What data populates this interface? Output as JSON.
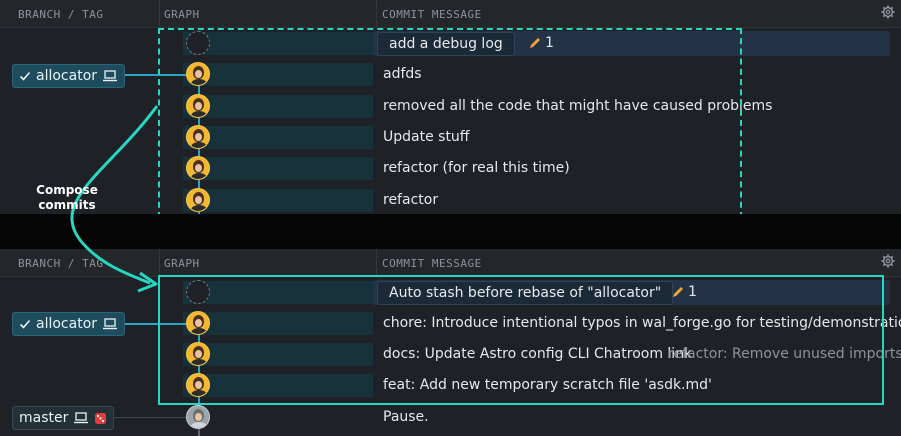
{
  "columns": {
    "branch": "BRANCH / TAG",
    "graph": "GRAPH",
    "message": "COMMIT MESSAGE"
  },
  "annotation": {
    "line1": "Compose",
    "line2": "commits"
  },
  "top_panel": {
    "branch_tag": "allocator",
    "wip": {
      "message": "add a debug log",
      "count": "1"
    },
    "commits": [
      "adfds",
      "removed all the code that might have caused problems",
      "Update stuff",
      "refactor (for real this time)",
      "refactor"
    ]
  },
  "bottom_panel": {
    "branch_tag": "allocator",
    "branch_tag_2": "master",
    "wip": {
      "message": "Auto stash before rebase of \"allocator\"",
      "count": "1"
    },
    "commits": [
      "chore: Introduce intentional typos in wal_forge.go for testing/demonstration",
      "docs: Update Astro config CLI Chatroom link",
      "feat: Add new temporary scratch file 'asdk.md'",
      "Pause."
    ],
    "dim_message": "refactor: Remove unused imports…"
  },
  "icons": [
    "gear-icon",
    "check-icon",
    "laptop-icon",
    "pencil-icon",
    "dice-icon"
  ],
  "colors": {
    "accent": "#28d6c2",
    "branch_line": "#2aa6c4",
    "avatar": "#f3b730",
    "wip_row": "#243246"
  }
}
